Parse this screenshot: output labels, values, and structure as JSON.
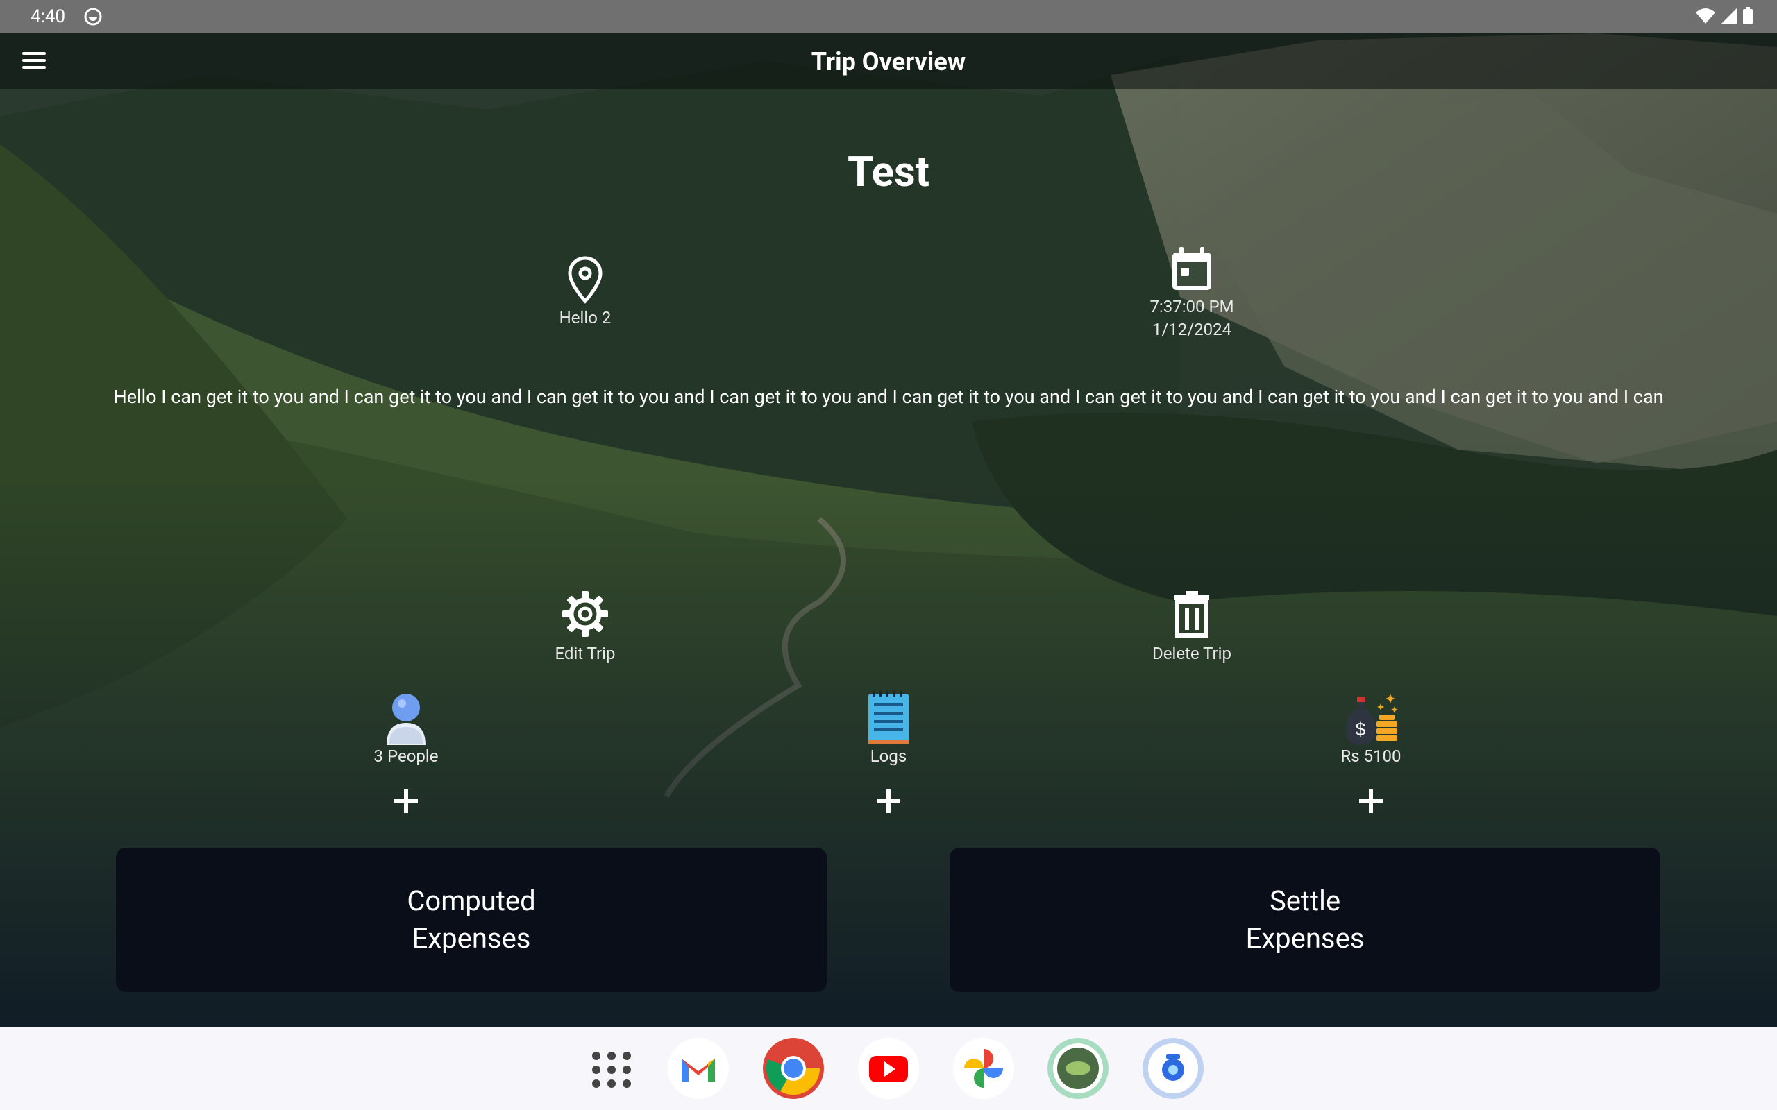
{
  "status_bar": {
    "time": "4:40"
  },
  "app_bar": {
    "title": "Trip Overview"
  },
  "trip": {
    "name": "Test",
    "location": "Hello 2",
    "time": "7:37:00 PM",
    "date": "1/12/2024",
    "description": "Hello I can get it to you and I can get it to you and I can get it to you and I can get it to you and I can get it to you and I can get it to you and I can get it to you and I can get it to you and I can"
  },
  "actions": {
    "edit": "Edit Trip",
    "delete": "Delete Trip"
  },
  "stats": {
    "people": "3 People",
    "logs": "Logs",
    "expenses": "Rs 5100"
  },
  "buttons": {
    "computed": "Computed Expenses",
    "settle": "Settle Expenses"
  },
  "dock": [
    "app-drawer-icon",
    "gmail-icon",
    "chrome-icon",
    "youtube-icon",
    "photos-icon",
    "trip-app-icon",
    "camera-icon"
  ]
}
